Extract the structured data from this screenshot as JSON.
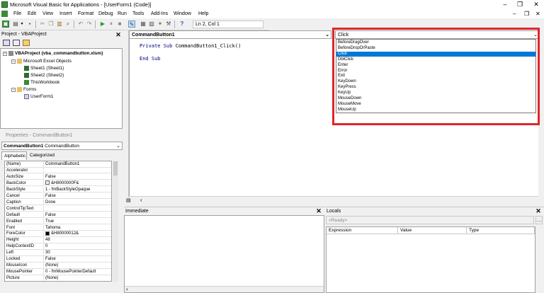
{
  "window": {
    "title": "Microsoft Visual Basic for Applications - [UserForm1 (Code)]",
    "controls": [
      "–",
      "❐",
      "✕"
    ],
    "mdi_controls": [
      "–",
      "❐",
      "✕"
    ]
  },
  "menu": [
    "File",
    "Edit",
    "View",
    "Insert",
    "Format",
    "Debug",
    "Run",
    "Tools",
    "Add-Ins",
    "Window",
    "Help"
  ],
  "toolbar": {
    "position": "Ln 2, Col 1"
  },
  "project": {
    "title": "Project - VBAProject",
    "root": "VBAProject (vba_commandbutton.xlsm)",
    "excel_objects": "Microsoft Excel Objects",
    "sheet1": "Sheet1 (Sheet1)",
    "sheet2": "Sheet2 (Sheet2)",
    "workbook": "ThisWorkbook",
    "forms": "Forms",
    "userform": "UserForm1"
  },
  "properties": {
    "title": "Properties - CommandButton1",
    "object_name": "CommandButton1",
    "object_type": "CommandButton",
    "tabs": [
      "Alphabetic",
      "Categorized"
    ],
    "rows": [
      {
        "name": "(Name)",
        "value": "CommandButton1"
      },
      {
        "name": "Accelerator",
        "value": ""
      },
      {
        "name": "AutoSize",
        "value": "False"
      },
      {
        "name": "BackColor",
        "value": "&H8000000F&",
        "swatch": "#f0f0f0"
      },
      {
        "name": "BackStyle",
        "value": "1 - fmBackStyleOpaque"
      },
      {
        "name": "Cancel",
        "value": "False"
      },
      {
        "name": "Caption",
        "value": "Done"
      },
      {
        "name": "ControlTipText",
        "value": ""
      },
      {
        "name": "Default",
        "value": "False"
      },
      {
        "name": "Enabled",
        "value": "True"
      },
      {
        "name": "Font",
        "value": "Tahoma"
      },
      {
        "name": "ForeColor",
        "value": "&H80000012&",
        "swatch": "#000000"
      },
      {
        "name": "Height",
        "value": "48"
      },
      {
        "name": "HelpContextID",
        "value": "0"
      },
      {
        "name": "Left",
        "value": "30"
      },
      {
        "name": "Locked",
        "value": "False"
      },
      {
        "name": "MouseIcon",
        "value": "(None)"
      },
      {
        "name": "MousePointer",
        "value": "0 - fmMousePointerDefault"
      },
      {
        "name": "Picture",
        "value": "(None)"
      }
    ]
  },
  "code": {
    "object": "CommandButton1",
    "procedure": "Click",
    "line1_kw": "Private Sub",
    "line1_rest": " CommandButton1_Click()",
    "line2": "End Sub"
  },
  "dropdown": {
    "items": [
      "BeforeDragOver",
      "BeforeDropOrPaste",
      "Click",
      "DblClick",
      "Enter",
      "Error",
      "Exit",
      "KeyDown",
      "KeyPress",
      "KeyUp",
      "MouseDown",
      "MouseMove",
      "MouseUp"
    ],
    "selected": "Click",
    "highlight_color": "#e0262c"
  },
  "immediate": {
    "title": "Immediate"
  },
  "locals": {
    "title": "Locals",
    "status": "<Ready>",
    "columns": [
      "Expression",
      "Value",
      "Type"
    ]
  }
}
